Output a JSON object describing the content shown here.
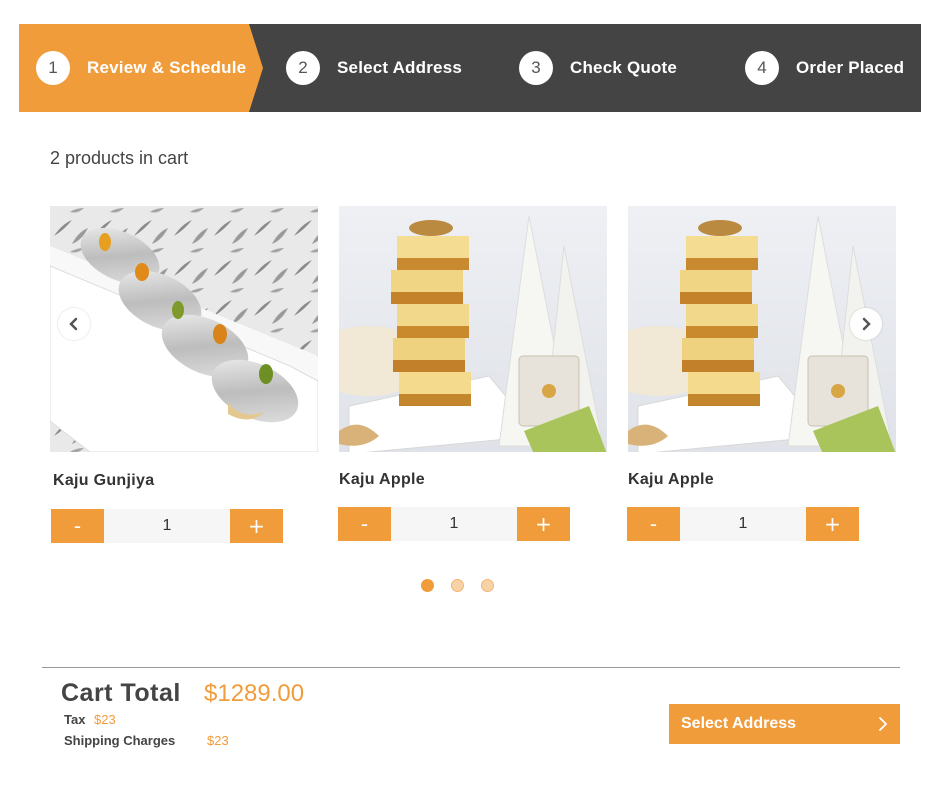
{
  "stepper": {
    "steps": [
      {
        "num": "1",
        "label": "Review & Schedule"
      },
      {
        "num": "2",
        "label": "Select Address"
      },
      {
        "num": "3",
        "label": "Check Quote"
      },
      {
        "num": "4",
        "label": "Order Placed"
      }
    ],
    "active_color": "#f19c3b",
    "bg_color": "#444444"
  },
  "cart": {
    "count_text": "2 products in cart"
  },
  "products": [
    {
      "name": "Kaju Gunjiya",
      "quantity": "1",
      "minus": "-",
      "plus": "+"
    },
    {
      "name": "Kaju Apple",
      "quantity": "1",
      "minus": "-",
      "plus": "+"
    },
    {
      "name": "Kaju Apple",
      "quantity": "1",
      "minus": "-",
      "plus": "+"
    }
  ],
  "carousel": {
    "prev_icon": "chevron-left-icon",
    "next_icon": "chevron-right-icon",
    "active_page": 1,
    "page_count": 3
  },
  "summary": {
    "total_label": "Cart Total",
    "total_value": "$1289.00",
    "tax_label": "Tax",
    "tax_value": "$23",
    "shipping_label": "Shipping Charges",
    "shipping_value": "$23",
    "button_label": "Select Address"
  },
  "colors": {
    "accent": "#f19c3b",
    "dark": "#444444"
  }
}
